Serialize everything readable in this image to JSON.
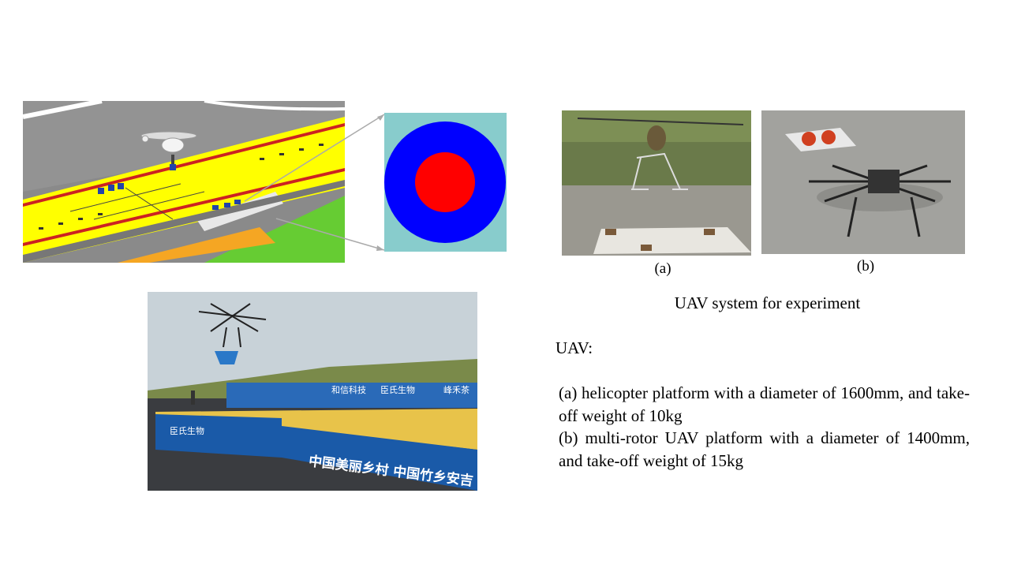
{
  "figure_labels": {
    "a": "(a)",
    "b": "(b)"
  },
  "figure_title": "UAV system for experiment",
  "text": {
    "heading": "UAV:",
    "item_a": "(a) helicopter platform with a diameter of 1600mm, and take-off weight of 10kg",
    "item_b": "(b) multi-rotor UAV platform with a diameter of 1400mm, and take-off weight of 15kg"
  },
  "banner_text": {
    "side": "中国美丽乡村 中国竹乡安吉",
    "board1": "和信科技",
    "board2": "臣氏生物",
    "board3": "峰禾茶",
    "left_side": "臣氏生物"
  },
  "colors": {
    "target_outer": "#0000ff",
    "target_inner": "#ff0000",
    "target_bg": "#88cccc",
    "deck_yellow": "#ffff00",
    "deck_grey": "#999999",
    "ground_green": "#66cc33"
  }
}
